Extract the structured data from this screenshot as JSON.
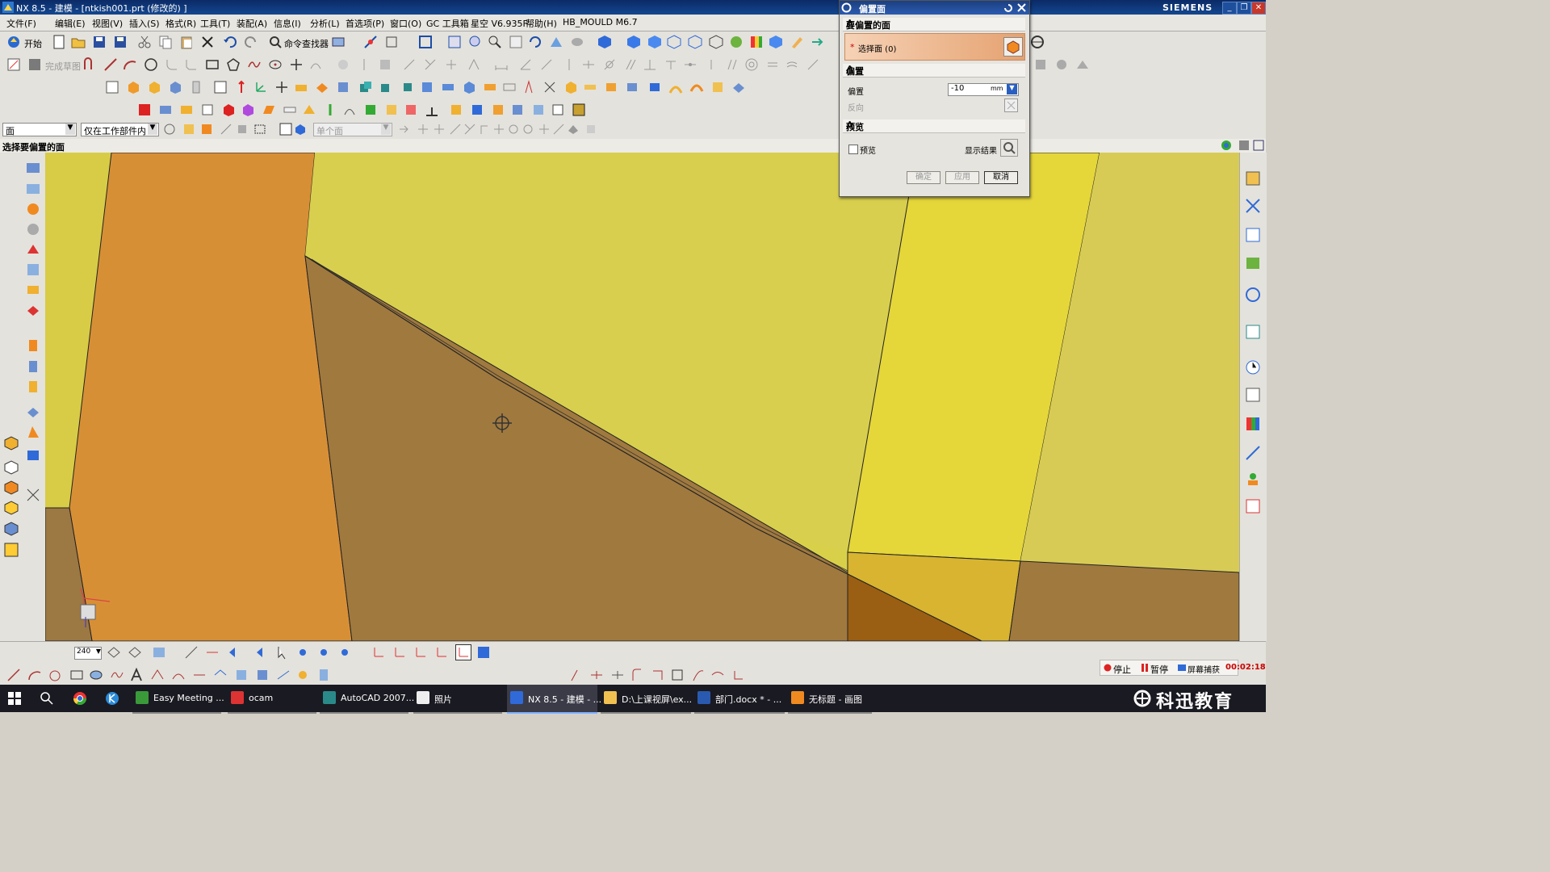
{
  "window": {
    "title": "NX 8.5 - 建模 - [ntkish001.prt  (修改的) ]",
    "brand": "SIEMENS"
  },
  "menu": [
    "文件(F)",
    "编辑(E)",
    "视图(V)",
    "插入(S)",
    "格式(R)",
    "工具(T)",
    "装配(A)",
    "信息(I)",
    "分析(L)",
    "首选项(P)",
    "窗口(O)",
    "GC 工具箱",
    "星空 V6.935F",
    "帮助(H)",
    "HB_MOULD M6.7"
  ],
  "toolbar": {
    "start_label": "开始",
    "command_finder_label": "命令查找器",
    "sketch_finish_label": "完成草图"
  },
  "selection_bar": {
    "filter_value": "面",
    "scope_value": "仅在工作部件内",
    "face_rule_value": "单个面"
  },
  "cue_line": "选择要偏置的面",
  "dialog": {
    "title": "偏置面",
    "section_faces": "要偏置的面",
    "select_face_label": "选择面 (0)",
    "section_offset": "偏置",
    "offset_label": "偏置",
    "offset_value": "-10",
    "offset_unit": "mm",
    "reverse_label": "反向",
    "section_preview": "预览",
    "preview_checkbox_label": "预览",
    "show_result_label": "显示结果",
    "ok_label": "确定",
    "apply_label": "应用",
    "cancel_label": "取消"
  },
  "bottom": {
    "zoom_value": "240"
  },
  "recorder": {
    "stop_label": "停止",
    "pause_label": "暂停",
    "capture_label": "屏幕捕获",
    "time": "00:02:18"
  },
  "taskbar": {
    "items": [
      {
        "label": "Easy Meeting ..."
      },
      {
        "label": "ocam"
      },
      {
        "label": "AutoCAD 2007..."
      },
      {
        "label": "照片"
      },
      {
        "label": "NX 8.5 - 建模 - ..."
      },
      {
        "label": "D:\\上课视屏\\ex..."
      },
      {
        "label": "部门.docx * - ..."
      },
      {
        "label": "无标题 - 画图"
      }
    ],
    "watermark": "科迅教育"
  },
  "colors": {
    "face_yellow": "#d9d04a",
    "face_orange": "#d89035",
    "face_brown": "#a07840",
    "face_bright_yellow": "#e4d43a",
    "dialog_selected": "#f0b486"
  }
}
